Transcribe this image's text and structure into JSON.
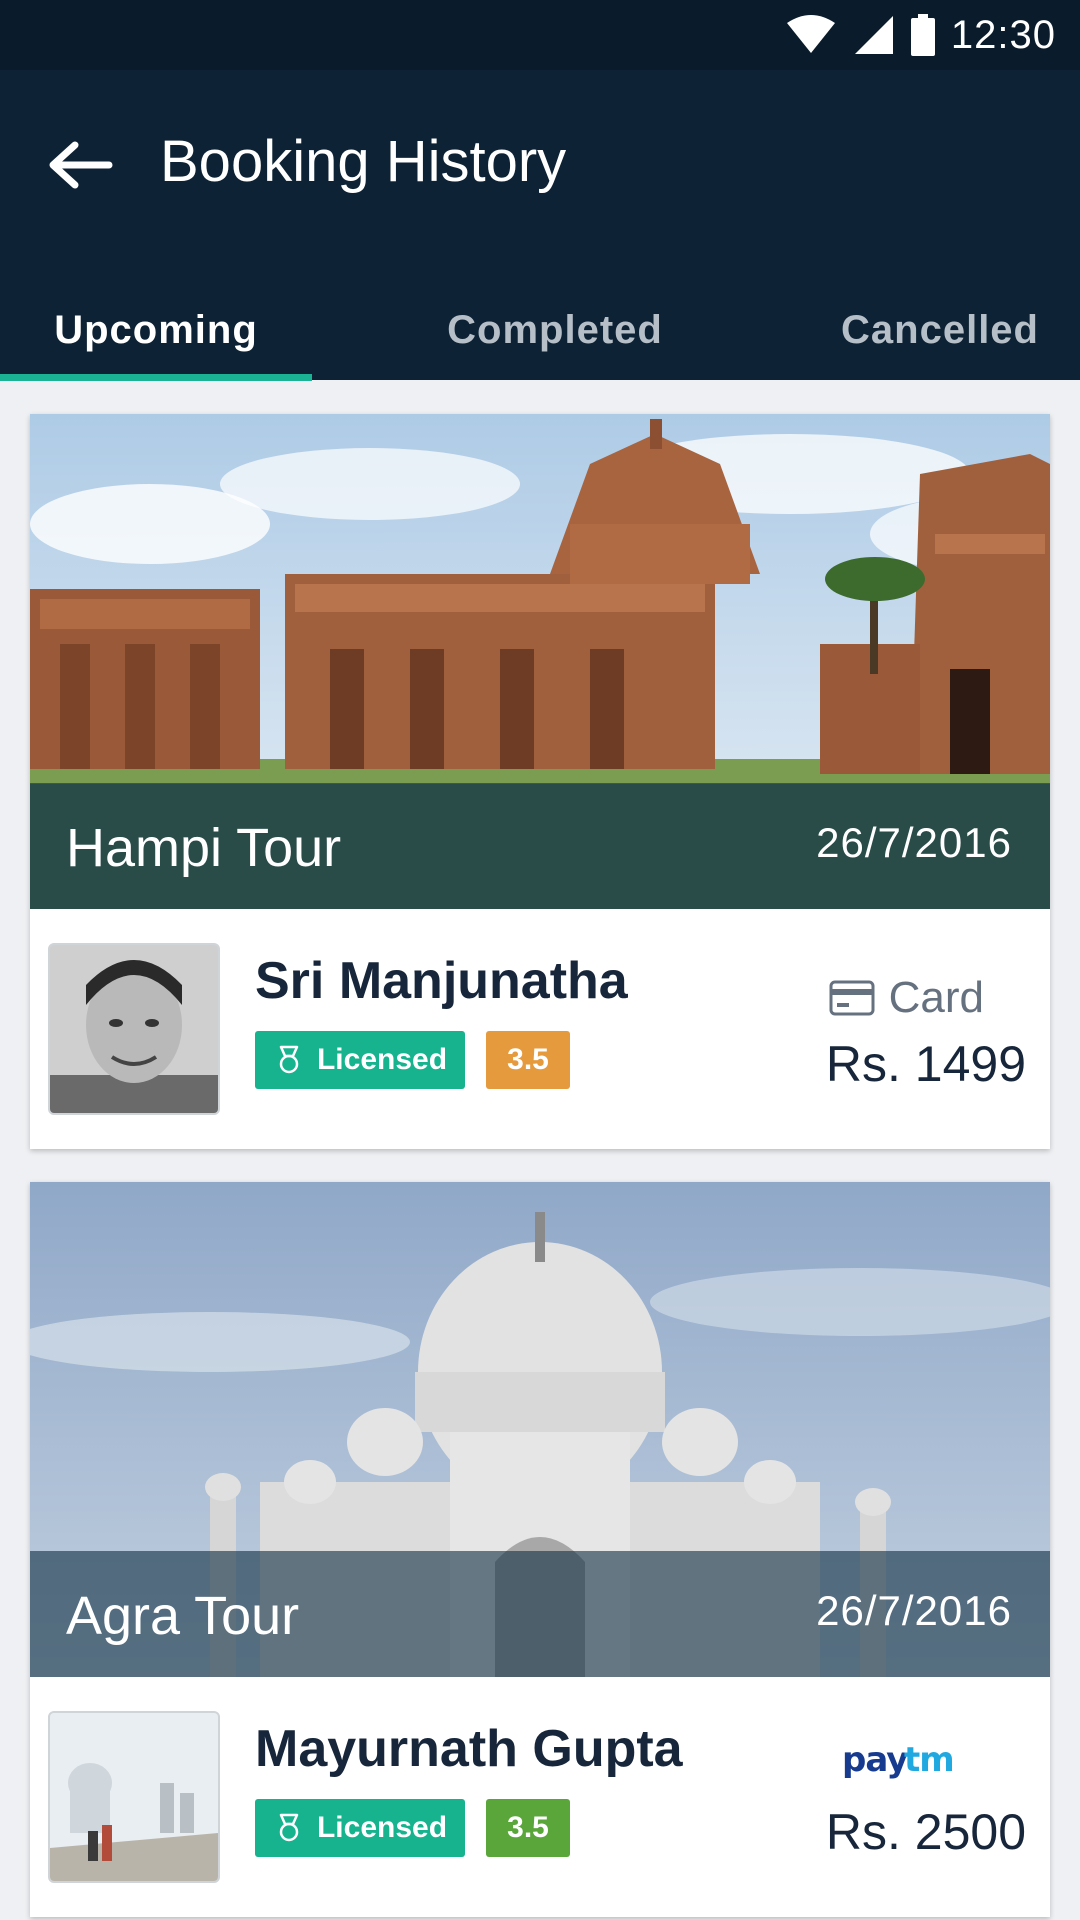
{
  "status_bar": {
    "time": "12:30"
  },
  "app_bar": {
    "title": "Booking History"
  },
  "tabs": [
    {
      "label": "Upcoming",
      "active": true
    },
    {
      "label": "Completed",
      "active": false
    },
    {
      "label": "Cancelled",
      "active": false
    }
  ],
  "bookings": [
    {
      "tour_name": "Hampi Tour",
      "date": "26/7/2016",
      "guide_name": "Sri Manjunatha",
      "licensed_label": "Licensed",
      "rating": "3.5",
      "rating_color": "#e59a3d",
      "payment_method": "Card",
      "price": "Rs. 1499"
    },
    {
      "tour_name": "Agra Tour",
      "date": "26/7/2016",
      "guide_name": "Mayurnath Gupta",
      "licensed_label": "Licensed",
      "rating": "3.5",
      "rating_color": "#5aa63b",
      "payment_method": "Paytm",
      "price": "Rs. 2500"
    }
  ],
  "colors": {
    "status_bar": "#0a1c2b",
    "app_bar": "#0d2234",
    "accent": "#1ab394",
    "licensed_badge": "#17b38f"
  }
}
